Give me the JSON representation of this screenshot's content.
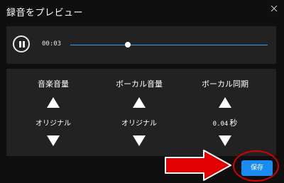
{
  "dialog": {
    "title": "録音をプレビュー",
    "close_icon": "close-icon"
  },
  "player": {
    "state_icon": "pause-icon",
    "time": "00:03",
    "progress_fraction": 0.29,
    "accent_color": "#3aa0f0"
  },
  "controls": [
    {
      "label": "音楽音量",
      "value": "オリジナル",
      "unit": ""
    },
    {
      "label": "ボーカル音量",
      "value": "オリジナル",
      "unit": ""
    },
    {
      "label": "ボーカル同期",
      "value": "0.04",
      "unit": "秒"
    }
  ],
  "footer": {
    "save_label": "保存",
    "save_color": "#1a8bf0",
    "annotation_color": "#d40000"
  }
}
